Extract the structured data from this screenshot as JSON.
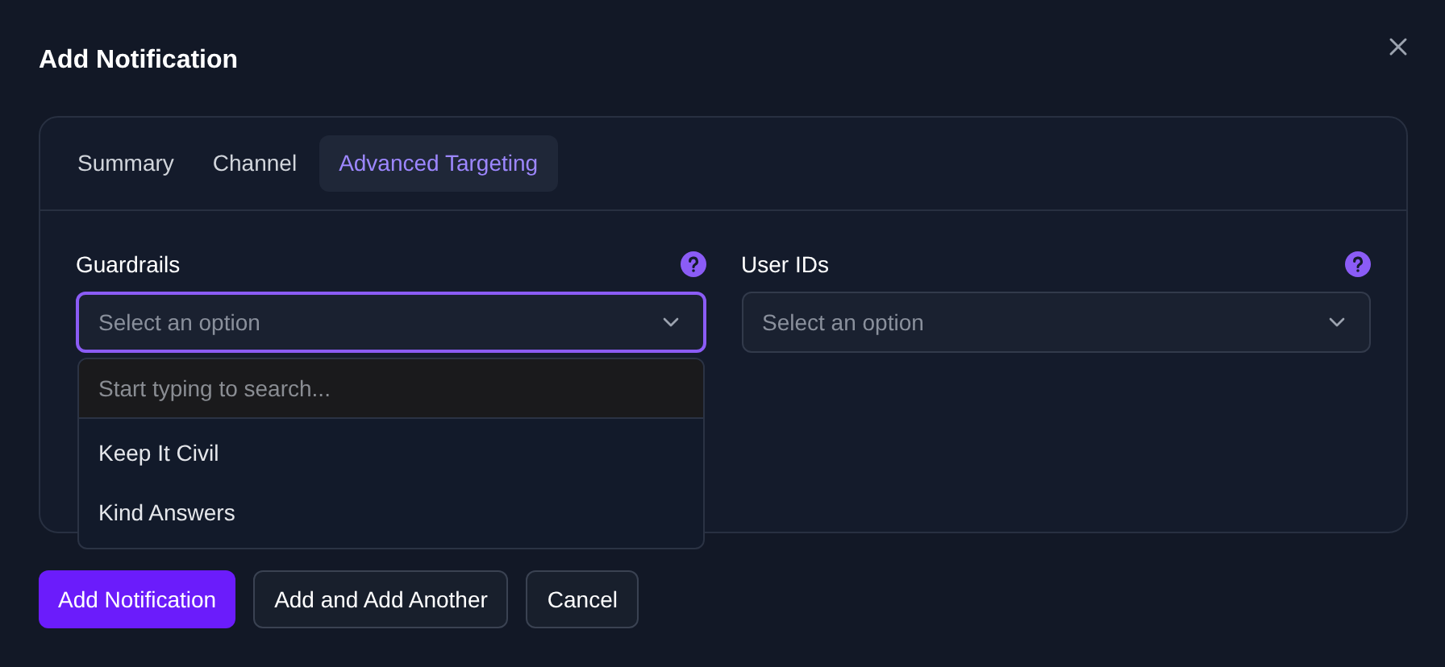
{
  "dialog": {
    "title": "Add Notification",
    "tabs": [
      {
        "label": "Summary",
        "selected": false
      },
      {
        "label": "Channel",
        "selected": false
      },
      {
        "label": "Advanced Targeting",
        "selected": true
      }
    ],
    "fields": [
      {
        "label": "Guardrails",
        "placeholder": "Select an option",
        "focused": true
      },
      {
        "label": "User IDs",
        "placeholder": "Select an option",
        "focused": false
      }
    ],
    "dropdown": {
      "search_placeholder": "Start typing to search...",
      "options": [
        "Keep It Civil",
        "Kind Answers"
      ]
    },
    "buttons": [
      {
        "label": "Add Notification",
        "kind": "primary"
      },
      {
        "label": "Add and Add Another",
        "kind": "secondary"
      },
      {
        "label": "Cancel",
        "kind": "secondary"
      }
    ]
  }
}
